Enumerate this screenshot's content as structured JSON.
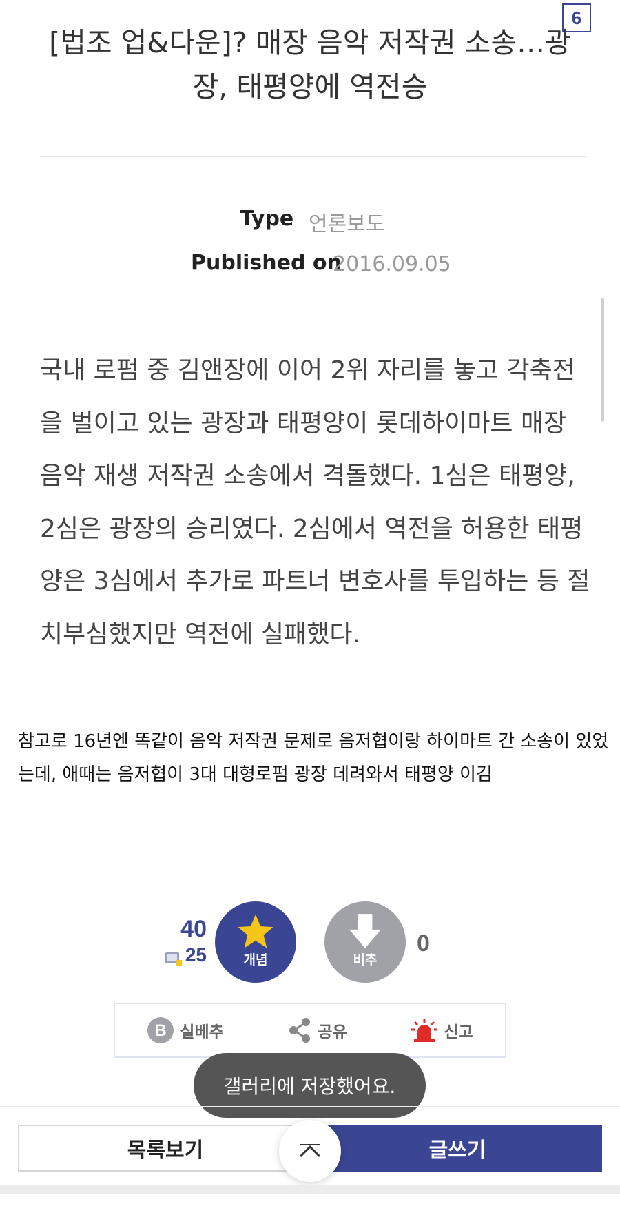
{
  "badge": "6",
  "article": {
    "title": "[법조 업&다운]? 매장 음악 저작권 소송…광장, 태평양에 역전승",
    "type_label": "Type",
    "type_value": "언론보도",
    "published_label": "Published on",
    "published_value": "2016.09.05",
    "body": "국내 로펌 중 김앤장에 이어 2위 자리를 놓고 각축전을 벌이고 있는 광장과 태평양이 롯데하이마트 매장 음악 재생 저작권 소송에서 격돌했다. 1심은 태평양, 2심은 광장의 승리였다. 2심에서 역전을 허용한 태평양은 3심에서 추가로 파트너 변호사를 투입하는 등 절치부심했지만 역전에 실패했다."
  },
  "note": "참고로 16년엔 똑같이 음악 저작권 문제로 음저협이랑 하이마트 간 소송이 있었는데, 애때는 음저협이 3대 대형로펌 광장 데려와서 태평양 이김",
  "votes": {
    "up_count": "40",
    "up_sub_count": "25",
    "up_label": "개념",
    "down_label": "비추",
    "down_count": "0"
  },
  "actions": {
    "best_label": "실베추",
    "share_label": "공유",
    "report_label": "신고"
  },
  "toast": "갤러리에 저장했어요.",
  "bottom": {
    "list_label": "목록보기",
    "write_label": "글쓰기"
  },
  "colors": {
    "accent": "#3a4594",
    "down": "#a1a1a8",
    "star": "#f5c518",
    "report": "#e02b2b"
  }
}
